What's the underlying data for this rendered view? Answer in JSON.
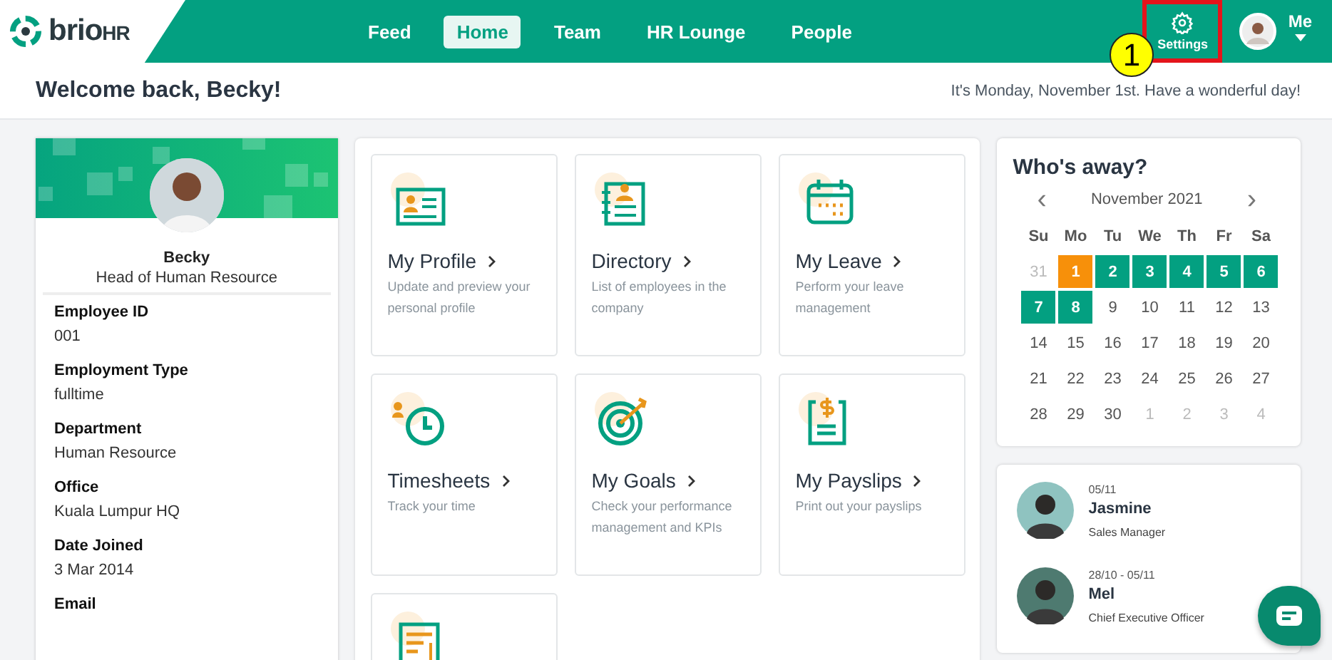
{
  "header": {
    "logo": {
      "mark": "brio",
      "suffix": "HR"
    },
    "nav": [
      {
        "label": "Feed",
        "selected": false
      },
      {
        "label": "Home",
        "selected": true
      },
      {
        "label": "Team",
        "selected": false
      },
      {
        "label": "HR Lounge",
        "selected": false
      },
      {
        "label": "People",
        "selected": false
      }
    ],
    "settings": {
      "label": "Settings",
      "highlighted": true
    },
    "callout": "1",
    "user": {
      "label": "Me"
    }
  },
  "welcome": {
    "title": "Welcome back, Becky!",
    "message": "It's Monday, November 1st. Have a wonderful day!"
  },
  "profile": {
    "name": "Becky",
    "role": "Head of Human Resource",
    "fields": [
      {
        "label": "Employee ID",
        "value": "001"
      },
      {
        "label": "Employment Type",
        "value": "fulltime"
      },
      {
        "label": "Department",
        "value": "Human Resource"
      },
      {
        "label": "Office",
        "value": "Kuala Lumpur HQ"
      },
      {
        "label": "Date Joined",
        "value": "3 Mar 2014"
      },
      {
        "label": "Email"
      }
    ]
  },
  "tiles": [
    {
      "kind": "profile",
      "title": "My Profile",
      "description": "Update and preview your personal profile"
    },
    {
      "kind": "directory",
      "title": "Directory",
      "description": "List of employees in the company"
    },
    {
      "kind": "leave",
      "title": "My Leave",
      "description": "Perform your leave management"
    },
    {
      "kind": "timesheets",
      "title": "Timesheets",
      "description": "Track your time"
    },
    {
      "kind": "goals",
      "title": "My Goals",
      "description": "Check your performance management and KPIs"
    },
    {
      "kind": "payslips",
      "title": "My Payslips",
      "description": "Print out your payslips"
    },
    {
      "kind": "claims"
    }
  ],
  "away": {
    "title": "Who's away?",
    "month": "November 2021",
    "prev": "‹",
    "next": "›",
    "weekdays": [
      "Su",
      "Mo",
      "Tu",
      "We",
      "Th",
      "Fr",
      "Sa"
    ],
    "days": [
      {
        "label": "31",
        "kind": "outside"
      },
      {
        "label": "1",
        "kind": "today"
      },
      {
        "label": "2",
        "kind": "away"
      },
      {
        "label": "3",
        "kind": "away"
      },
      {
        "label": "4",
        "kind": "away"
      },
      {
        "label": "5",
        "kind": "away"
      },
      {
        "label": "6",
        "kind": "away"
      },
      {
        "label": "7",
        "kind": "away"
      },
      {
        "label": "8",
        "kind": "away"
      },
      {
        "label": "9",
        "kind": "normal"
      },
      {
        "label": "10",
        "kind": "normal"
      },
      {
        "label": "11",
        "kind": "normal"
      },
      {
        "label": "12",
        "kind": "normal"
      },
      {
        "label": "13",
        "kind": "normal"
      },
      {
        "label": "14",
        "kind": "normal"
      },
      {
        "label": "15",
        "kind": "normal"
      },
      {
        "label": "16",
        "kind": "normal"
      },
      {
        "label": "17",
        "kind": "normal"
      },
      {
        "label": "18",
        "kind": "normal"
      },
      {
        "label": "19",
        "kind": "normal"
      },
      {
        "label": "20",
        "kind": "normal"
      },
      {
        "label": "21",
        "kind": "normal"
      },
      {
        "label": "22",
        "kind": "normal"
      },
      {
        "label": "23",
        "kind": "normal"
      },
      {
        "label": "24",
        "kind": "normal"
      },
      {
        "label": "25",
        "kind": "normal"
      },
      {
        "label": "26",
        "kind": "normal"
      },
      {
        "label": "27",
        "kind": "normal"
      },
      {
        "label": "28",
        "kind": "normal"
      },
      {
        "label": "29",
        "kind": "normal"
      },
      {
        "label": "30",
        "kind": "normal"
      },
      {
        "label": "1",
        "kind": "outside"
      },
      {
        "label": "2",
        "kind": "outside"
      },
      {
        "label": "3",
        "kind": "outside"
      },
      {
        "label": "4",
        "kind": "outside"
      }
    ],
    "people": [
      {
        "dates": "05/11",
        "name": "Jasmine",
        "role": "Sales Manager",
        "color": "#8fc3c0"
      },
      {
        "dates": "28/10 - 05/11",
        "name": "Mel",
        "role": "Chief Executive Officer",
        "color": "#4e7a70"
      }
    ]
  }
}
